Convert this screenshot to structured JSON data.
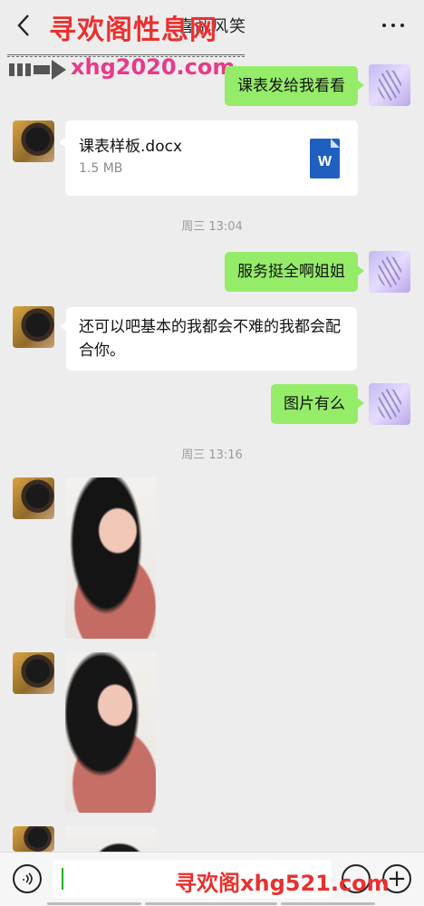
{
  "header": {
    "title": "喜乱风笑",
    "back_icon": "chevron-left-icon",
    "more_icon": "ellipsis-icon"
  },
  "watermark": {
    "top_text": "寻欢阁性息网",
    "url": "xhg2020.com",
    "bottom_text": "寻欢阁xhg521.com"
  },
  "messages": [
    {
      "sender": "me",
      "type": "text",
      "text": "课表发给我看看"
    },
    {
      "sender": "other",
      "type": "file",
      "file_name": "课表样板.docx",
      "file_size": "1.5 MB",
      "file_icon": "word-doc-icon",
      "file_icon_letter": "W"
    },
    {
      "type": "timestamp",
      "text": "周三 13:04"
    },
    {
      "sender": "me",
      "type": "text",
      "text": "服务挺全啊姐姐"
    },
    {
      "sender": "other",
      "type": "text",
      "text": "还可以吧基本的我都会不难的我都会配合你。"
    },
    {
      "sender": "me",
      "type": "text",
      "text": "图片有么"
    },
    {
      "type": "timestamp",
      "text": "周三 13:16"
    },
    {
      "sender": "other",
      "type": "image"
    },
    {
      "sender": "other",
      "type": "image"
    },
    {
      "sender": "other",
      "type": "image"
    }
  ],
  "input_bar": {
    "voice_icon": "voice-icon",
    "emoji_icon": "emoji-icon",
    "plus_icon": "plus-icon",
    "input_value": ""
  },
  "colors": {
    "background": "#ededed",
    "my_bubble": "#95ec69",
    "other_bubble": "#ffffff",
    "watermark_red": "#e8312f",
    "watermark_pink": "#e83a8a"
  }
}
